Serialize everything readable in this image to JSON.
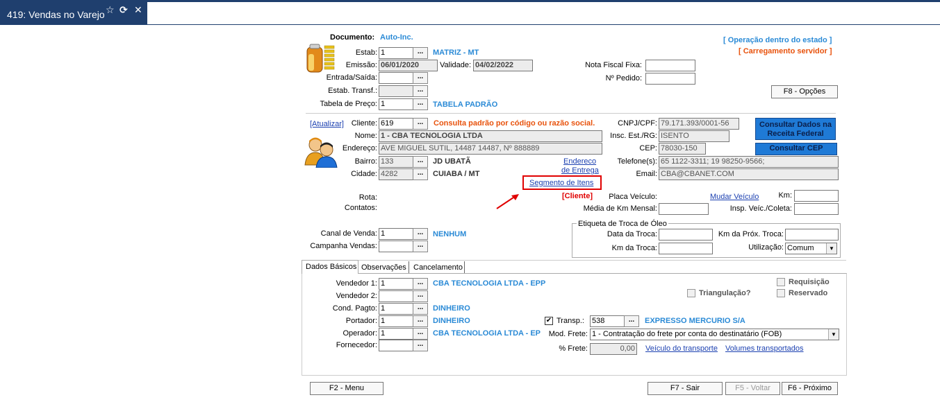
{
  "window": {
    "title": "419: Vendas no Varejo"
  },
  "documento": {
    "label": "Documento:",
    "value": "Auto-Inc."
  },
  "status": {
    "operacao": "[ Operação dentro do estado ]",
    "carregamento": "[ Carregamento servidor ]"
  },
  "header": {
    "estab_label": "Estab:",
    "estab_value": "1",
    "estab_desc": "MATRIZ - MT",
    "emissao_label": "Emissão:",
    "emissao_value": "06/01/2020",
    "validade_label": "Validade:",
    "validade_value": "04/02/2022",
    "entrada_label": "Entrada/Saída:",
    "estab_transf_label": "Estab. Transf.:",
    "tabela_label": "Tabela de Preço:",
    "tabela_value": "1",
    "tabela_desc": "TABELA PADRÃO",
    "nf_fixa_label": "Nota Fiscal Fixa:",
    "pedido_label": "Nº Pedido:",
    "opcoes_button": "F8 - Opções"
  },
  "cliente": {
    "atualizar_link": "[Atualizar]",
    "cliente_label": "Cliente:",
    "cliente_value": "619",
    "consulta_hint": "Consulta padrão por código ou razão social.",
    "nome_label": "Nome:",
    "nome_value": "1 - CBA TECNOLOGIA LTDA",
    "endereco_label": "Endereço:",
    "endereco_value": "AVE MIGUEL SUTIL, 14487 14487, Nº 888889",
    "bairro_label": "Bairro:",
    "bairro_value": "133",
    "bairro_desc": "JD UBATÃ",
    "cidade_label": "Cidade:",
    "cidade_value": "4282",
    "cidade_desc": "CUIABA / MT",
    "endereco_entrega_1": "Endereco",
    "endereco_entrega_2": "de Entrega",
    "segmento_link": "Segmento de Itens",
    "cliente_tag": "[Cliente]",
    "cnpj_label": "CNPJ/CPF:",
    "cnpj_value": "79.171.393/0001-56",
    "insc_label": "Insc. Est./RG:",
    "insc_value": "ISENTO",
    "cep_label": "CEP:",
    "cep_value": "78030-150",
    "telefone_label": "Telefone(s):",
    "telefone_value": "65 1122-3311; 19 98250-9566;",
    "email_label": "Email:",
    "email_value": "CBA@CBANET.COM",
    "consultar_receita": "Consultar Dados na Receita Federal",
    "consultar_cep": "Consultar CEP"
  },
  "rota": {
    "rota_label": "Rota:",
    "contatos_label": "Contatos:",
    "placa_label": "Placa Veículo:",
    "mudar_veiculo": "Mudar Veículo",
    "km_label": "Km:",
    "media_label": "Média de Km Mensal:",
    "insp_label": "Insp. Veíc./Coleta:"
  },
  "canal": {
    "canal_label": "Canal de Venda:",
    "canal_value": "1",
    "canal_desc": "NENHUM",
    "campanha_label": "Campanha Vendas:"
  },
  "oleo": {
    "legend": "Etiqueta de Troca de Óleo",
    "data_label": "Data da Troca:",
    "km_prox_label": "Km da Próx. Troca:",
    "km_troca_label": "Km da Troca:",
    "utilizacao_label": "Utilização:",
    "utilizacao_value": "Comum"
  },
  "tabs": [
    {
      "label": "Dados Básicos"
    },
    {
      "label": "Observações"
    },
    {
      "label": "Cancelamento"
    }
  ],
  "basicos": {
    "vendedor1_label": "Vendedor 1:",
    "vendedor1_value": "1",
    "vendedor1_desc": "CBA TECNOLOGIA LTDA - EPP",
    "vendedor2_label": "Vendedor 2:",
    "cond_label": "Cond. Pagto:",
    "cond_value": "1",
    "cond_desc": "DINHEIRO",
    "portador_label": "Portador:",
    "portador_value": "1",
    "portador_desc": "DINHEIRO",
    "operador_label": "Operador:",
    "operador_value": "1",
    "operador_desc": "CBA TECNOLOGIA LTDA - EP",
    "fornecedor_label": "Fornecedor:",
    "triangulacao_label": "Triangulação?",
    "requisicao_label": "Requisição",
    "reservado_label": "Reservado",
    "transp_label": "Transp.:",
    "transp_value": "538",
    "transp_desc": "EXPRESSO MERCURIO S/A",
    "modfrete_label": "Mod. Frete:",
    "modfrete_value": "1 - Contratação do frete por conta do destinatário (FOB)",
    "pct_frete_label": "% Frete:",
    "pct_frete_value": "0,00",
    "veiculo_link": "Veículo do transporte",
    "volumes_link": "Volumes transportados"
  },
  "footer": {
    "menu": "F2 - Menu",
    "sair": "F7 - Sair",
    "voltar": "F5 - Voltar",
    "proximo": "F6 - Próximo"
  },
  "colors": {
    "titlebar": "#1f3f6e",
    "accent_blue": "#2a8ad6",
    "accent_orange": "#e8520c",
    "highlight_red": "#e00000"
  }
}
